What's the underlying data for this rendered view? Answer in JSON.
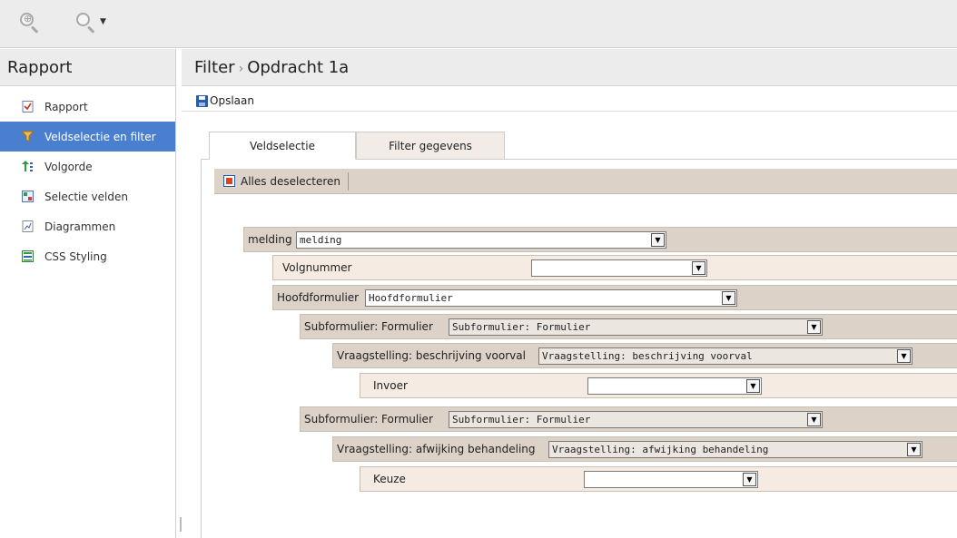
{
  "toolbar_icons": [
    "zoom-in-icon",
    "search-dropdown-icon"
  ],
  "sidebar": {
    "title": "Rapport",
    "items": [
      {
        "label": "Rapport",
        "icon": "report-icon",
        "active": false
      },
      {
        "label": "Veldselectie en filter",
        "icon": "filter-icon",
        "active": true
      },
      {
        "label": "Volgorde",
        "icon": "sort-order-icon",
        "active": false
      },
      {
        "label": "Selectie velden",
        "icon": "select-fields-icon",
        "active": false
      },
      {
        "label": "Diagrammen",
        "icon": "chart-icon",
        "active": false
      },
      {
        "label": "CSS Styling",
        "icon": "css-icon",
        "active": false
      }
    ]
  },
  "header": {
    "breadcrumb_root": "Filter",
    "breadcrumb_sep": "›",
    "breadcrumb_current": "Opdracht 1a"
  },
  "toolbar": {
    "save_label": "Opslaan"
  },
  "tabs": [
    {
      "label": "Veldselectie",
      "active": true
    },
    {
      "label": "Filter gegevens",
      "active": false
    }
  ],
  "panel": {
    "deselect_label": "Alles deselecteren"
  },
  "rows": [
    {
      "label": "melding",
      "select": "melding"
    },
    {
      "label": "Volgnummer",
      "select": ""
    },
    {
      "label": "Hoofdformulier",
      "select": "Hoofdformulier"
    },
    {
      "label": "Subformulier: Formulier",
      "select": "Subformulier: Formulier"
    },
    {
      "label": "Vraagstelling: beschrijving voorval",
      "select": "Vraagstelling: beschrijving voorval"
    },
    {
      "label": "Invoer",
      "select": ""
    },
    {
      "label": "Subformulier: Formulier",
      "select": "Subformulier: Formulier"
    },
    {
      "label": "Vraagstelling: afwijking behandeling",
      "select": "Vraagstelling: afwijking behandeling"
    },
    {
      "label": "Keuze",
      "select": ""
    }
  ],
  "colors": {
    "accent": "#4a7fd0",
    "row_dark": "#dcd2c8",
    "row_light": "#f5ebe3"
  }
}
